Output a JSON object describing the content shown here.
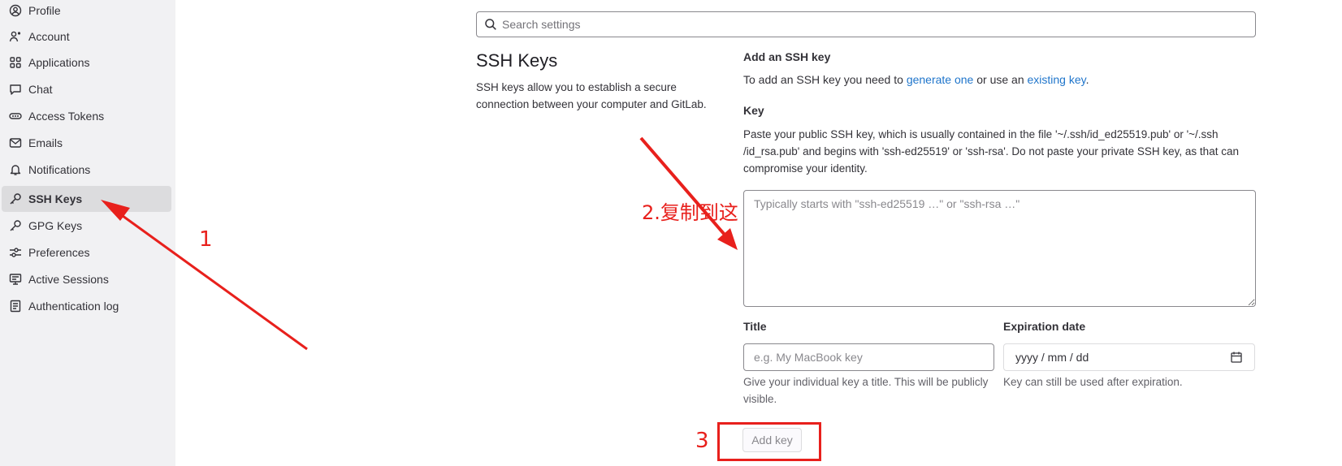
{
  "sidebar": {
    "items": [
      {
        "label": "Profile",
        "icon": "profile-icon"
      },
      {
        "label": "Account",
        "icon": "account-icon"
      },
      {
        "label": "Applications",
        "icon": "applications-icon"
      },
      {
        "label": "Chat",
        "icon": "chat-icon"
      },
      {
        "label": "Access Tokens",
        "icon": "token-icon"
      },
      {
        "label": "Emails",
        "icon": "mail-icon"
      },
      {
        "label": "Notifications",
        "icon": "bell-icon"
      },
      {
        "label": "SSH Keys",
        "icon": "key-icon",
        "active": true
      },
      {
        "label": "GPG Keys",
        "icon": "key-icon"
      },
      {
        "label": "Preferences",
        "icon": "preferences-icon"
      },
      {
        "label": "Active Sessions",
        "icon": "monitor-icon"
      },
      {
        "label": "Authentication log",
        "icon": "log-icon"
      }
    ]
  },
  "search": {
    "placeholder": "Search settings"
  },
  "section": {
    "title": "SSH Keys",
    "description": "SSH keys allow you to establish a secure connection between your computer and GitLab."
  },
  "form": {
    "add_heading": "Add an SSH key",
    "add_text_1": "To add an SSH key you need to ",
    "generate_link": "generate one",
    "add_text_2": " or use an ",
    "existing_link": "existing key",
    "add_text_3": ".",
    "key_label": "Key",
    "key_help": "Paste your public SSH key, which is usually contained in the file '~/.ssh/id_ed25519.pub' or '~/.ssh /id_rsa.pub' and begins with 'ssh-ed25519' or 'ssh-rsa'. Do not paste your private SSH key, as that can compromise your identity.",
    "key_placeholder": "Typically starts with \"ssh-ed25519 …\" or \"ssh-rsa …\"",
    "title_label": "Title",
    "title_placeholder": "e.g. My MacBook key",
    "title_help": "Give your individual key a title. This will be publicly visible.",
    "expiration_label": "Expiration date",
    "expiration_value": "yyyy / mm / dd",
    "expiration_help": "Key can still be used after expiration.",
    "add_button": "Add key"
  },
  "annotations": {
    "step1": "1",
    "step2": "2.复制到这",
    "step3": "3",
    "color": "#e8201c"
  },
  "colors": {
    "link": "#1f75cb",
    "sidebar_bg": "#f1f1f3",
    "active_bg": "#dcdcde"
  }
}
